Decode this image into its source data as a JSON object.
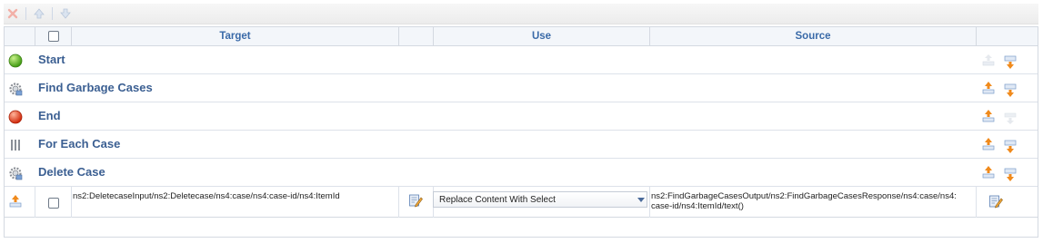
{
  "toolbar": {
    "icons": [
      "delete-icon",
      "move-up-icon",
      "move-down-icon"
    ]
  },
  "table": {
    "headers": {
      "target": "Target",
      "use": "Use",
      "source": "Source"
    },
    "rows": [
      {
        "title": "Start",
        "icon": "start-green-circle-icon"
      },
      {
        "title": "Find Garbage Cases",
        "icon": "gear-icon"
      },
      {
        "title": "End",
        "icon": "end-red-circle-icon"
      },
      {
        "title": "For Each Case",
        "icon": "loop-bars-icon"
      },
      {
        "title": "Delete Case",
        "icon": "gear-icon"
      }
    ],
    "mapping_row": {
      "target": "ns2:DeletecaseInput/ns2:Deletecase/ns4:case/ns4:case-id/ns4:ItemId",
      "use": "Replace Content With Select",
      "source_line1": "ns2:FindGarbageCasesOutput/ns2:FindGarbageCasesResponse/ns4:case/ns4:",
      "source_line2": "case-id/ns4:ItemId/text()"
    }
  },
  "colors": {
    "title_text": "#3b5f92",
    "header_text": "#3a6aa8",
    "header_bg": "#f3f6fa",
    "border": "#d4d9e1"
  }
}
